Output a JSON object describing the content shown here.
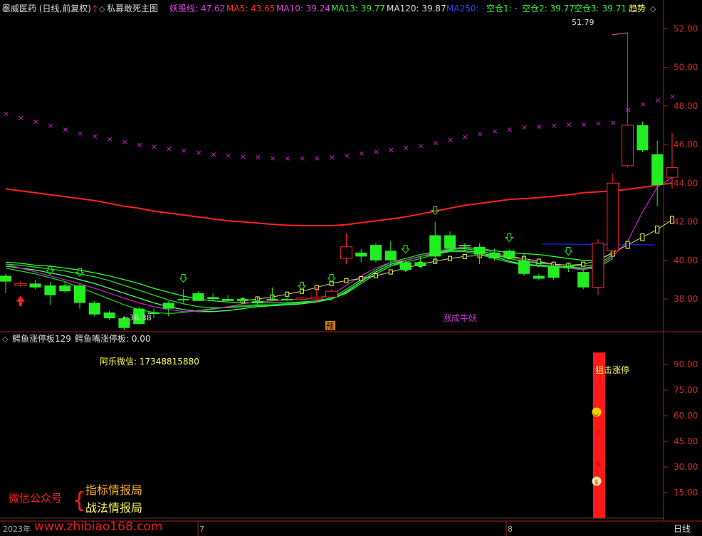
{
  "main_header": {
    "stock": "恩威医药 (日线,前复权)",
    "indicator": "私募敢死主图",
    "yao": "妖股线: 47.62",
    "ma5": "MA5: 43.65",
    "ma10": "MA10: 39.24",
    "ma13": "MA13: 39.77",
    "ma120": "MA120: 39.87",
    "ma250": "MA250: -",
    "kc1": "空仓1: -",
    "kc2": "空仓2: 39.77",
    "kc3": "空仓3: 39.71",
    "trend": "趋势"
  },
  "sub_header": {
    "name": "鳄鱼涨停板129",
    "value": "鳄鱼嘴涨停板: 0.00"
  },
  "annotations": {
    "high": "51.79",
    "low": "←36.38",
    "yu": "预",
    "zhangcheng": "涨成牛妖",
    "wechat": "阿乐微信: 17348815880",
    "juji": "狙击涨停",
    "wx_gzh": "微信公众号",
    "brace": "{",
    "zhibiao": "指标情报局",
    "zhanfa": "战法情报局",
    "watermark": "www.zhibiao168.com"
  },
  "x_axis": {
    "year": "2023年",
    "m7": "7",
    "m8": "8",
    "period": "日线"
  },
  "colors": {
    "up": "#ff2a2a",
    "down": "#22ee22",
    "ma120": "#ff2020",
    "yao": "#d020d0",
    "ma250": "#1a2aff",
    "frame": "#b01818",
    "yellow": "#ffff60",
    "magenta": "#cc33cc"
  },
  "chart_data": [
    {
      "type": "candlestick",
      "title": "私募敢死主图",
      "ylim": [
        36.6,
        52.6
      ],
      "y_ticks": [
        "52.00",
        "50.00",
        "48.00",
        "46.00",
        "44.00",
        "42.00",
        "40.00",
        "38.00"
      ],
      "candles": [
        {
          "o": 39.2,
          "h": 39.3,
          "l": 38.3,
          "c": 38.9
        },
        {
          "o": 38.7,
          "h": 38.9,
          "l": 38.6,
          "c": 38.8
        },
        {
          "o": 38.8,
          "h": 39.0,
          "l": 38.5,
          "c": 38.6
        },
        {
          "o": 38.7,
          "h": 38.9,
          "l": 37.7,
          "c": 38.2
        },
        {
          "o": 38.7,
          "h": 38.9,
          "l": 38.3,
          "c": 38.4
        },
        {
          "o": 38.7,
          "h": 38.8,
          "l": 37.5,
          "c": 37.8
        },
        {
          "o": 37.8,
          "h": 37.9,
          "l": 37.1,
          "c": 37.2
        },
        {
          "o": 37.3,
          "h": 37.4,
          "l": 36.9,
          "c": 37.0
        },
        {
          "o": 37.0,
          "h": 37.1,
          "l": 36.38,
          "c": 36.5
        },
        {
          "o": 37.5,
          "h": 37.6,
          "l": 36.7,
          "c": 36.7
        },
        {
          "o": 37.3,
          "h": 37.5,
          "l": 37.0,
          "c": 37.3
        },
        {
          "o": 37.8,
          "h": 37.9,
          "l": 37.1,
          "c": 37.5
        },
        {
          "o": 38.0,
          "h": 38.5,
          "l": 37.8,
          "c": 38.0
        },
        {
          "o": 38.3,
          "h": 38.4,
          "l": 37.9,
          "c": 37.9
        },
        {
          "o": 38.1,
          "h": 38.3,
          "l": 37.9,
          "c": 38.0
        },
        {
          "o": 38.0,
          "h": 38.2,
          "l": 37.9,
          "c": 37.9
        },
        {
          "o": 38.0,
          "h": 38.1,
          "l": 37.8,
          "c": 37.9
        },
        {
          "o": 37.9,
          "h": 38.1,
          "l": 37.6,
          "c": 37.8
        },
        {
          "o": 38.0,
          "h": 38.6,
          "l": 37.9,
          "c": 38.0
        },
        {
          "o": 38.0,
          "h": 38.1,
          "l": 37.9,
          "c": 37.95
        },
        {
          "o": 38.0,
          "h": 38.1,
          "l": 37.9,
          "c": 38.05
        },
        {
          "o": 38.0,
          "h": 38.6,
          "l": 37.8,
          "c": 38.1
        },
        {
          "o": 38.1,
          "h": 38.5,
          "l": 37.9,
          "c": 38.4
        },
        {
          "o": 40.1,
          "h": 41.4,
          "l": 39.8,
          "c": 40.7
        },
        {
          "o": 40.4,
          "h": 40.6,
          "l": 39.9,
          "c": 40.2
        },
        {
          "o": 40.8,
          "h": 40.9,
          "l": 39.9,
          "c": 40.0
        },
        {
          "o": 40.5,
          "h": 41.0,
          "l": 39.7,
          "c": 40.0
        },
        {
          "o": 39.9,
          "h": 40.0,
          "l": 39.4,
          "c": 39.5
        },
        {
          "o": 39.9,
          "h": 40.2,
          "l": 39.6,
          "c": 39.7
        },
        {
          "o": 41.3,
          "h": 42.0,
          "l": 39.8,
          "c": 40.2
        },
        {
          "o": 41.3,
          "h": 41.5,
          "l": 40.5,
          "c": 40.6
        },
        {
          "o": 40.8,
          "h": 40.9,
          "l": 40.5,
          "c": 40.8
        },
        {
          "o": 40.7,
          "h": 40.9,
          "l": 39.8,
          "c": 40.3
        },
        {
          "o": 40.4,
          "h": 40.6,
          "l": 40.0,
          "c": 40.1
        },
        {
          "o": 40.5,
          "h": 40.6,
          "l": 40.0,
          "c": 40.1
        },
        {
          "o": 40.0,
          "h": 40.4,
          "l": 39.2,
          "c": 39.3
        },
        {
          "o": 39.2,
          "h": 39.3,
          "l": 39.0,
          "c": 39.05
        },
        {
          "o": 39.7,
          "h": 39.8,
          "l": 39.0,
          "c": 39.1
        },
        {
          "o": 39.7,
          "h": 39.9,
          "l": 39.4,
          "c": 39.6
        },
        {
          "o": 39.4,
          "h": 39.5,
          "l": 38.5,
          "c": 38.6
        },
        {
          "o": 38.6,
          "h": 41.1,
          "l": 38.2,
          "c": 40.9
        },
        {
          "o": 40.5,
          "h": 44.5,
          "l": 40.3,
          "c": 44.0
        },
        {
          "o": 44.9,
          "h": 51.79,
          "l": 44.8,
          "c": 47.0
        },
        {
          "o": 47.0,
          "h": 47.2,
          "l": 45.6,
          "c": 45.7
        },
        {
          "o": 45.5,
          "h": 46.2,
          "l": 42.8,
          "c": 43.9
        },
        {
          "o": 44.3,
          "h": 46.6,
          "l": 43.7,
          "c": 44.8
        }
      ],
      "ma120": [
        43.7,
        43.6,
        43.5,
        43.4,
        43.3,
        43.2,
        43.1,
        42.95,
        42.8,
        42.7,
        42.55,
        42.45,
        42.35,
        42.25,
        42.15,
        42.05,
        42.0,
        41.93,
        41.87,
        41.82,
        41.8,
        41.8,
        41.8,
        41.85,
        41.95,
        42.05,
        42.15,
        42.25,
        42.4,
        42.55,
        42.7,
        42.85,
        42.95,
        43.05,
        43.15,
        43.2,
        43.25,
        43.32,
        43.4,
        43.5,
        43.55,
        43.6,
        43.68,
        43.78,
        43.9,
        44.0
      ],
      "ma10": [
        39.8,
        39.6,
        39.4,
        39.2,
        39.0,
        38.8,
        38.55,
        38.3,
        38.05,
        37.8,
        37.6,
        37.45,
        37.35,
        37.35,
        37.45,
        37.6,
        37.75,
        37.85,
        37.9,
        37.95,
        38.0,
        38.05,
        38.2,
        38.7,
        39.2,
        39.6,
        39.9,
        40.0,
        40.2,
        40.4,
        40.6,
        40.7,
        40.6,
        40.4,
        40.2,
        40.0,
        39.9,
        39.8,
        39.6,
        39.5,
        39.7,
        40.2,
        41.0,
        42.5,
        43.8,
        44.3
      ],
      "yao_x": [
        47.6,
        47.4,
        47.2,
        47.0,
        46.8,
        46.6,
        46.45,
        46.3,
        46.15,
        46.0,
        45.9,
        45.8,
        45.7,
        45.6,
        45.5,
        45.45,
        45.4,
        45.35,
        45.3,
        45.3,
        45.3,
        45.3,
        45.35,
        45.45,
        45.55,
        45.65,
        45.75,
        45.85,
        45.95,
        46.1,
        46.25,
        46.4,
        46.55,
        46.7,
        46.8,
        46.9,
        46.95,
        47.0,
        47.05,
        47.05,
        47.1,
        47.15,
        47.8,
        48.1,
        48.3,
        48.5
      ],
      "kc_lines": [
        [
          39.9,
          39.85,
          39.75,
          39.7,
          39.6,
          39.5,
          39.35,
          39.2,
          39.0,
          38.8,
          38.55,
          38.35,
          38.15,
          38.0,
          37.9,
          37.85,
          37.8,
          37.8,
          37.8,
          37.8,
          37.85,
          37.9,
          38.0,
          38.3,
          38.8,
          39.3,
          39.7,
          40.0,
          40.2,
          40.4,
          40.55,
          40.65,
          40.6,
          40.5,
          40.4,
          40.35,
          40.3,
          40.2,
          40.1,
          40.0,
          40.0,
          40.4
        ],
        [
          39.8,
          39.75,
          39.65,
          39.55,
          39.45,
          39.3,
          39.15,
          38.95,
          38.7,
          38.45,
          38.2,
          37.95,
          37.75,
          37.6,
          37.55,
          37.55,
          37.6,
          37.65,
          37.7,
          37.75,
          37.8,
          37.9,
          38.05,
          38.5,
          39.0,
          39.5,
          39.9,
          40.1,
          40.3,
          40.45,
          40.6,
          40.6,
          40.5,
          40.3,
          40.1,
          39.95,
          39.85,
          39.8,
          39.75,
          39.7,
          39.8,
          40.3
        ],
        [
          39.7,
          39.6,
          39.5,
          39.35,
          39.2,
          39.0,
          38.8,
          38.55,
          38.3,
          38.05,
          37.8,
          37.6,
          37.45,
          37.35,
          37.35,
          37.4,
          37.5,
          37.6,
          37.65,
          37.7,
          37.75,
          37.85,
          38.0,
          38.4,
          38.9,
          39.4,
          39.8,
          40.0,
          40.2,
          40.35,
          40.5,
          40.5,
          40.4,
          40.2,
          39.95,
          39.8,
          39.75,
          39.7,
          39.65,
          39.6,
          39.7,
          40.2
        ],
        [
          39.6,
          39.45,
          39.3,
          39.1,
          38.9,
          38.6,
          38.3,
          38.0,
          37.7,
          37.45,
          37.3,
          37.25,
          37.3,
          37.4,
          37.5,
          37.6,
          37.65,
          37.7,
          37.7,
          37.75,
          37.8,
          37.9,
          38.05,
          38.35,
          38.8,
          39.3,
          39.7,
          39.9,
          40.1,
          40.3,
          40.45,
          40.45,
          40.3,
          40.1,
          39.9,
          39.75,
          39.7,
          39.65,
          39.6,
          39.55,
          39.6,
          40.1
        ]
      ],
      "trend_box_line": [
        37.9,
        38.0,
        38.1,
        38.25,
        38.4,
        38.6,
        38.8,
        38.95,
        39.05,
        39.2,
        39.4,
        39.6,
        39.8,
        39.95,
        40.1,
        40.2,
        40.25,
        40.25,
        40.2,
        40.1,
        39.95,
        39.8,
        39.75,
        39.8,
        40.0,
        40.4,
        40.8,
        41.2,
        41.6,
        42.1
      ],
      "ma250_segment": [
        40.85,
        40.8
      ],
      "buy_arrow_bar": 1,
      "signal_arrows": [
        3,
        5,
        12,
        20,
        22,
        27,
        29,
        34,
        36,
        38
      ]
    },
    {
      "type": "bar",
      "title": "鳄鱼涨停板129",
      "ylim": [
        0,
        100
      ],
      "y_ticks": [
        "90.00",
        "75.00",
        "60.00",
        "45.00",
        "30.00",
        "15.00"
      ],
      "bar_index": 39,
      "bar_value": 97
    }
  ]
}
